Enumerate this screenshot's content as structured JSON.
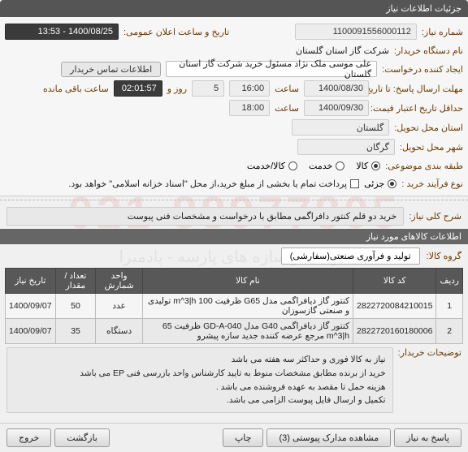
{
  "watermark": {
    "number": "021-88977805",
    "text": "فراگستر سازه های پارسه - پادمیرا"
  },
  "header": {
    "title": "جزئیات اطلاعات نیاز"
  },
  "form": {
    "need_no_label": "شماره نیاز:",
    "need_no_value": "1100091556000112",
    "announce_label": "تاریخ و ساعت اعلان عمومی:",
    "announce_value": "1400/08/25 - 13:53",
    "buyer_org_label": "نام دستگاه خریدار:",
    "buyer_org_value": "شرکت گاز استان گلستان",
    "requester_label": "ایجاد کننده درخواست:",
    "requester_value": "علی موسی ملک نژاد مسئول خرید شرکت گاز استان گلستان",
    "contact_btn": "اطلاعات تماس خریدار",
    "reply_deadline_label": "مهلت ارسال پاسخ: تا تاریخ:",
    "reply_date": "1400/08/30",
    "time_lbl": "ساعت",
    "reply_time": "16:00",
    "days_value": "5",
    "days_suffix": "روز و",
    "countdown": "02:01:57",
    "remain_suffix": "ساعت باقی مانده",
    "valid_label": "حداقل تاریخ اعتبار قیمت: تا تاریخ:",
    "valid_date": "1400/09/30",
    "valid_time": "18:00",
    "province_label": "استان محل تحویل:",
    "province_value": "گلستان",
    "city_label": "شهر محل تحویل:",
    "city_value": "گرگان",
    "subject_type_label": "طبقه بندی موضوعی:",
    "radio_kala": "کالا",
    "radio_khadmat": "خدمت",
    "radio_kalakhadmat": "کالا/خدمت",
    "process_label": "نوع فرآیند خرید :",
    "radio_partial": "جزئی",
    "process_note": "پرداخت تمام یا بخشی از مبلغ خرید،از محل \"اسناد خزانه اسلامی\" خواهد بود."
  },
  "summary": {
    "label": "شرح کلی نیاز:",
    "text": "خرید دو قلم کنتور دافراگمی مطابق با درخواست و مشخصات فنی پیوست"
  },
  "goods": {
    "header": "اطلاعات کالاهای مورد نیاز",
    "group_label": "گروه کالا:",
    "group_value": "تولید و فرآوری صنعتی(سفارشی)"
  },
  "table": {
    "cols": [
      "ردیف",
      "کد کالا",
      "نام کالا",
      "واحد شمارش",
      "تعداد / مقدار",
      "تاریخ نیاز"
    ],
    "rows": [
      {
        "n": "1",
        "code": "2822720084210015",
        "name": "کنتور گاز دیافراگمی مدل G65 ظرفیت 100 m^3|h تولیدی و صنعتی گازسوزان",
        "unit": "عدد",
        "qty": "50",
        "date": "1400/09/07"
      },
      {
        "n": "2",
        "code": "2822720160180006",
        "name": "کنتور گاز دیافراگمی G40 مدل GD-A-040 ظرفیت 65 m^3|h مرجع عرضه کننده جدید سازه پیشرو",
        "unit": "دستگاه",
        "qty": "35",
        "date": "1400/09/07"
      }
    ]
  },
  "notes": {
    "label": "توضیحات خریدار:",
    "lines": [
      "نیاز به کالا فوری و حداکثر سه هفته می باشد",
      "خرید از برنده مطابق مشخصات منوط به تایید کارشناس واحد بازرسی فنی EP می باشد",
      "هزینه حمل تا مقصد به عهده فروشنده می باشد .",
      "تکمیل و ارسال فایل پیوست الزامی می باشد."
    ]
  },
  "footer": {
    "respond": "پاسخ به نیاز",
    "attachments": "مشاهده مدارک پیوستی (3)",
    "print": "چاپ",
    "back": "بازگشت",
    "exit": "خروج"
  }
}
